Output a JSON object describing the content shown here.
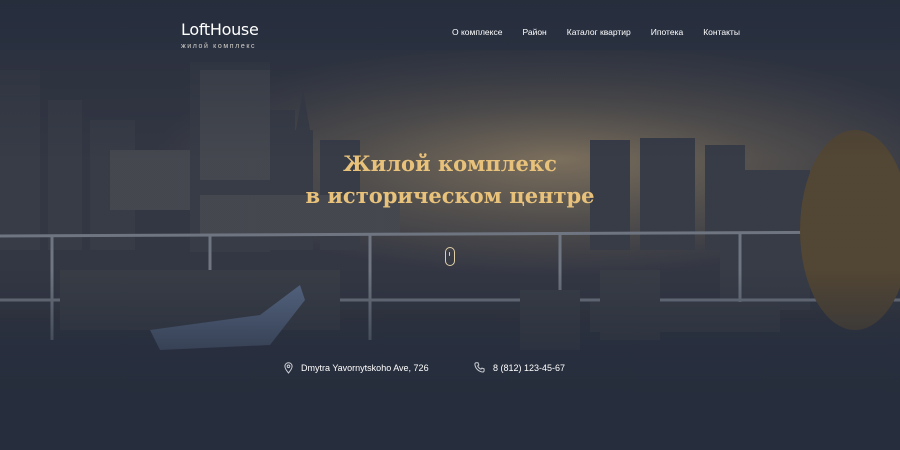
{
  "brand": {
    "name": "LoftHouse",
    "tagline": "жилой комплекс"
  },
  "nav": {
    "items": [
      {
        "label": "О комплексе"
      },
      {
        "label": "Район"
      },
      {
        "label": "Каталог квартир"
      },
      {
        "label": "Ипотека"
      },
      {
        "label": "Контакты"
      }
    ]
  },
  "hero": {
    "title_line1": "Жилой комплекс",
    "title_line2": "в историческом центре"
  },
  "contacts": {
    "address": "Dmytra Yavornytskoho Ave, 726",
    "phone": "8 (812) 123-45-67",
    "address_icon": "location-pin-icon",
    "phone_icon": "phone-icon"
  },
  "colors": {
    "background": "#2a3141",
    "accent": "#e8c27a",
    "text": "#ffffff"
  }
}
